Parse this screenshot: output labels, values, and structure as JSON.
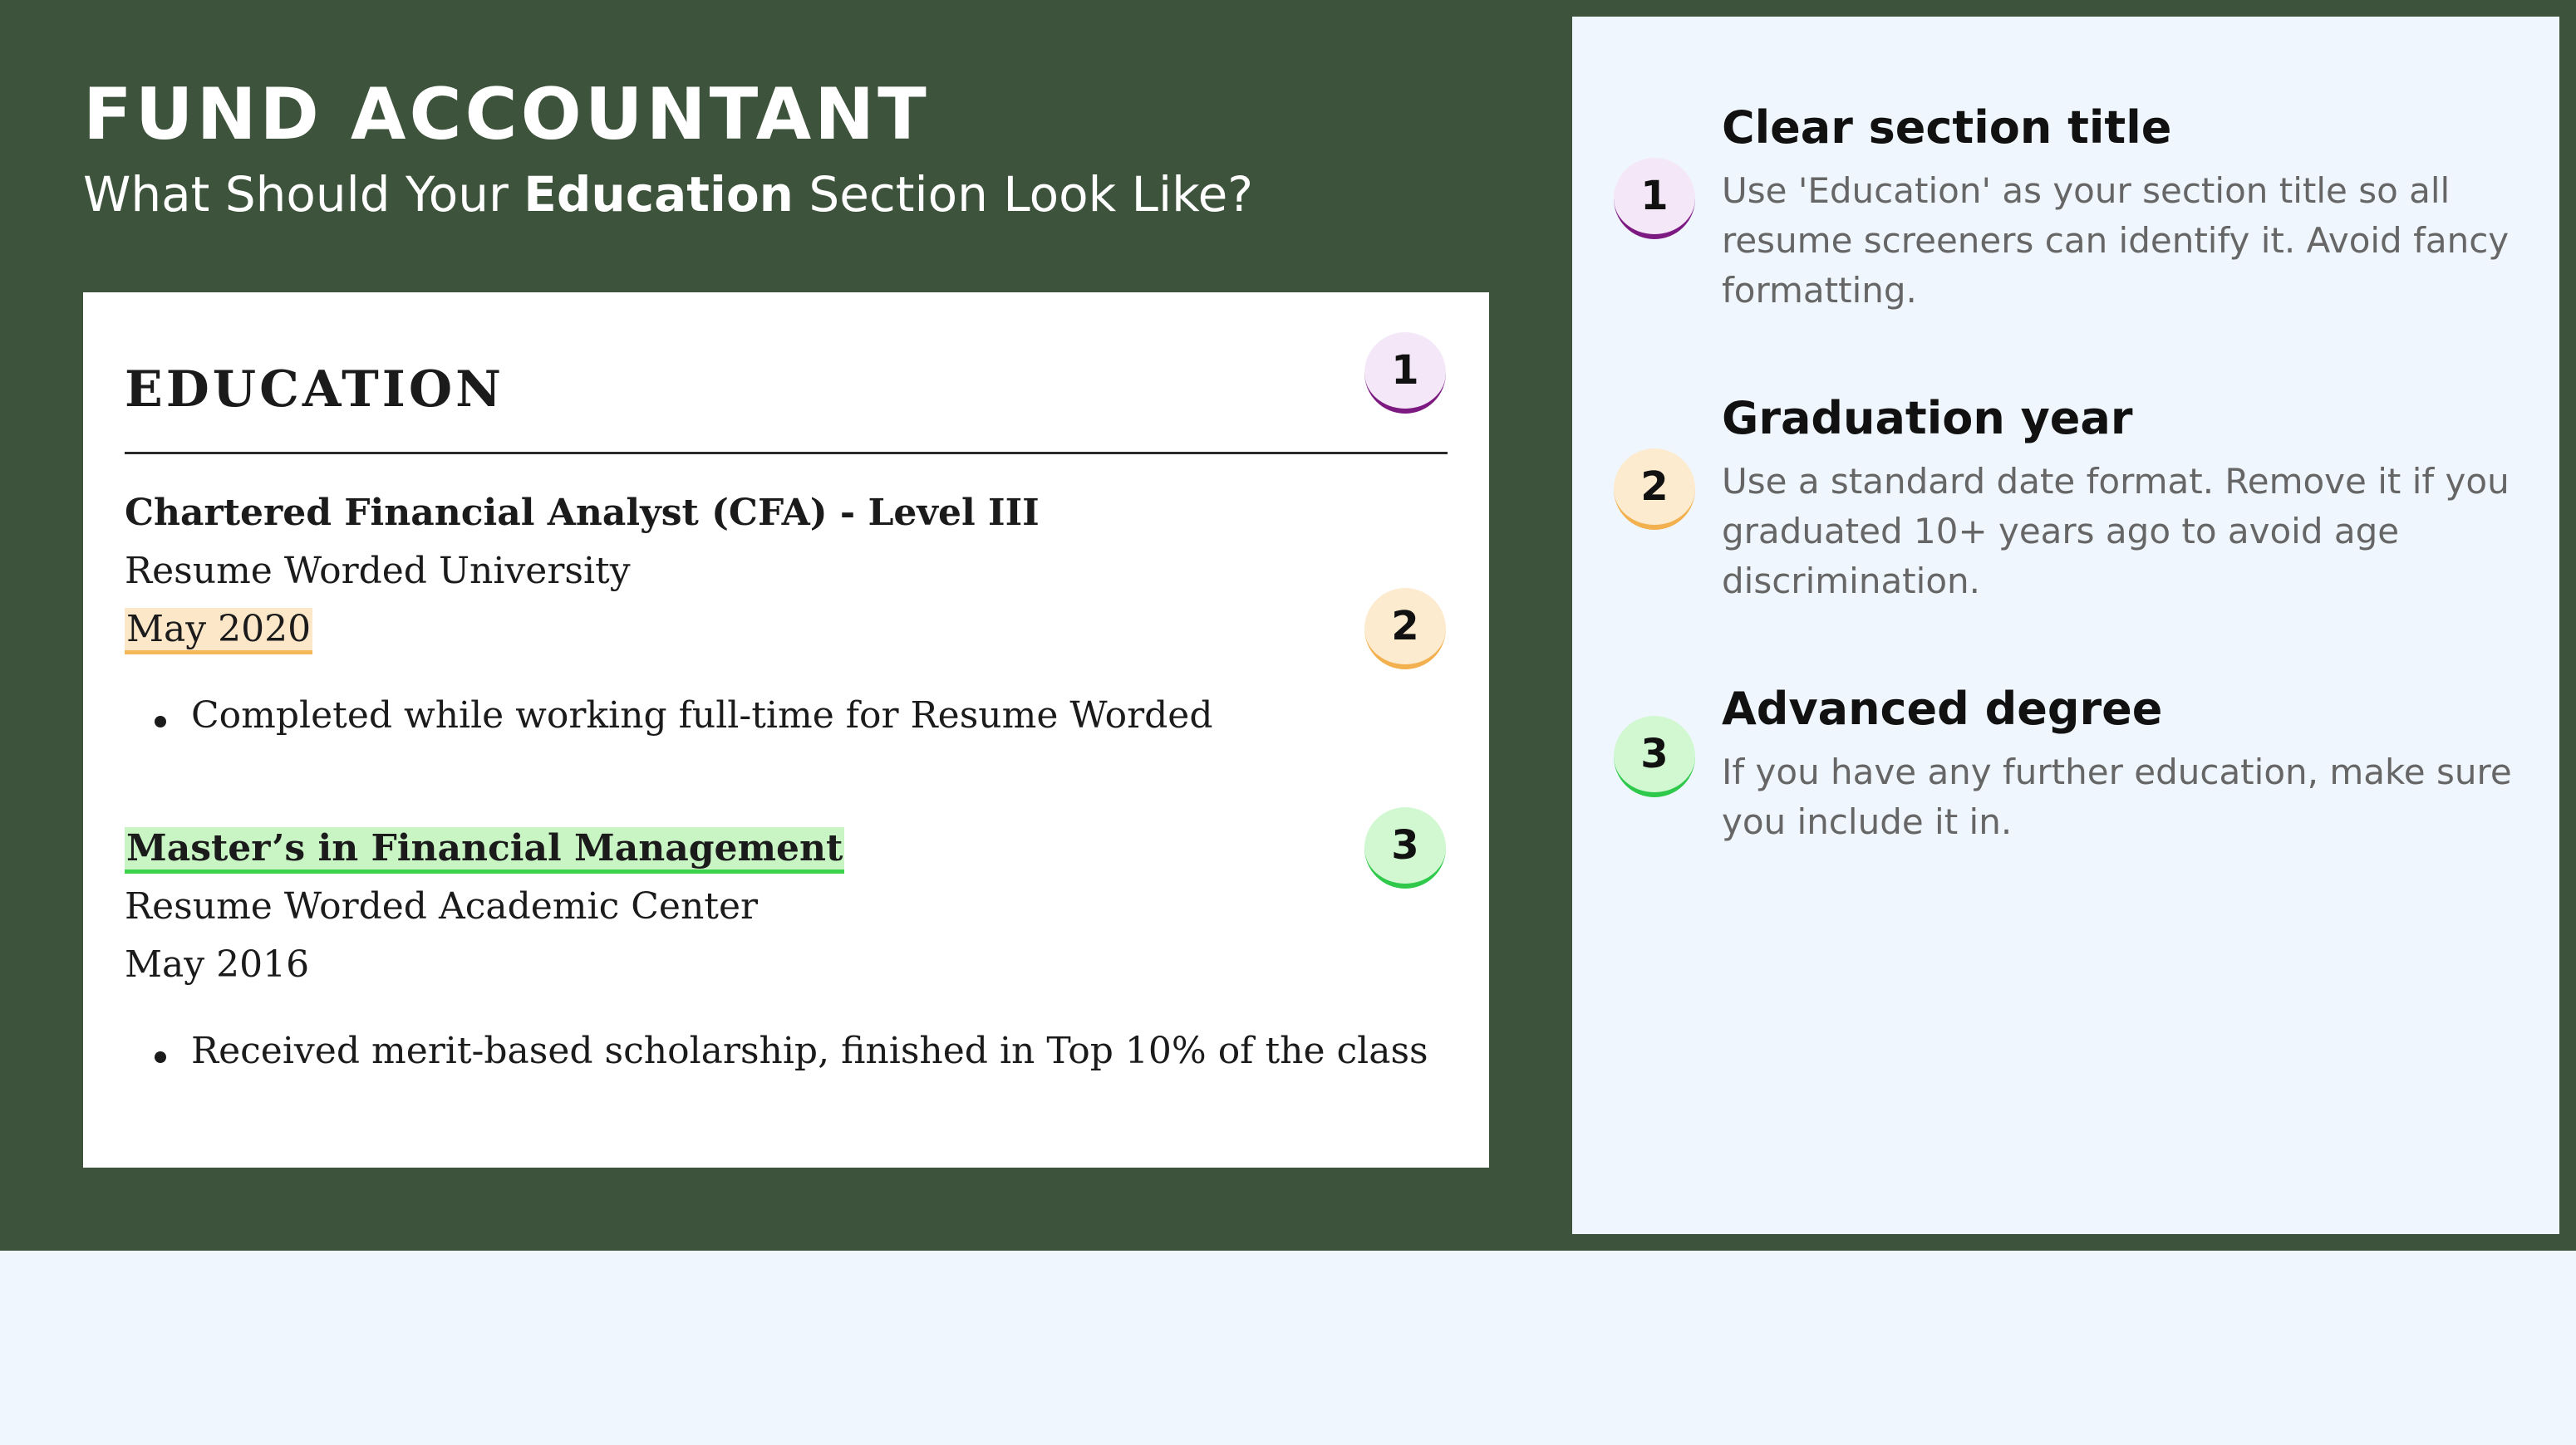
{
  "header": {
    "title": "FUND ACCOUNTANT",
    "subtitle_before": "What Should Your ",
    "subtitle_strong": "Education",
    "subtitle_after": " Section Look Like?"
  },
  "resume": {
    "section_heading": "EDUCATION",
    "entries": [
      {
        "degree": "Chartered Financial Analyst (CFA) - Level III",
        "school": "Resume Worded University",
        "date": "May 2020",
        "bullet": "Completed while working full-time for Resume Worded"
      },
      {
        "degree": "Master’s in Financial Management",
        "school": "Resume Worded Academic Center",
        "date": "May 2016",
        "bullet": "Received merit-based scholarship, finished in Top 10% of the class"
      }
    ]
  },
  "badges": [
    "1",
    "2",
    "3"
  ],
  "tips": [
    {
      "number": "1",
      "title": "Clear section title",
      "body": "Use 'Education' as your section title so all resume screeners can identify it. Avoid fancy formatting."
    },
    {
      "number": "2",
      "title": "Graduation year",
      "body": "Use a standard date format. Remove it if you graduated 10+ years ago to avoid age discrimination."
    },
    {
      "number": "3",
      "title": "Advanced degree",
      "body": "If you have any further education, make sure you include it in."
    }
  ],
  "colors": {
    "background_green": "#3e533b",
    "panel_light_blue": "#eff6fd",
    "badge1_accent": "#7d1a82",
    "badge2_accent": "#f2b04e",
    "badge3_accent": "#2ec94a",
    "date_highlight": "#fde7c9",
    "degree_highlight": "#c9f4c4"
  }
}
